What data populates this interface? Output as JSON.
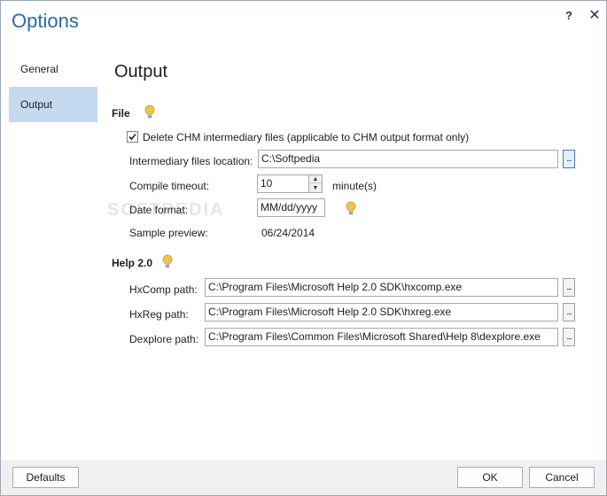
{
  "window": {
    "title": "Options"
  },
  "titlebar": {
    "help_label": "?",
    "close_label": "✕"
  },
  "sidebar": {
    "items": [
      {
        "label": "General"
      },
      {
        "label": "Output"
      }
    ]
  },
  "main": {
    "title": "Output",
    "file_section": {
      "label": "File",
      "delete_checkbox": {
        "label": "Delete CHM intermediary files (applicable to CHM output format only)",
        "checked": true
      },
      "intermediary_label": "Intermediary files location:",
      "intermediary_value": "C:\\Softpedia",
      "compile_label": "Compile timeout:",
      "compile_value": "10",
      "compile_unit": "minute(s)",
      "date_format_label": "Date format:",
      "date_format_value": "MM/dd/yyyy",
      "sample_label": "Sample preview:",
      "sample_value": "06/24/2014"
    },
    "help_section": {
      "label": "Help 2.0",
      "hxcomp_label": "HxComp path:",
      "hxcomp_value": "C:\\Program Files\\Microsoft Help 2.0 SDK\\hxcomp.exe",
      "hxreg_label": "HxReg path:",
      "hxreg_value": "C:\\Program Files\\Microsoft Help 2.0 SDK\\hxreg.exe",
      "dexplore_label": "Dexplore path:",
      "dexplore_value": "C:\\Program Files\\Common Files\\Microsoft Shared\\Help 8\\dexplore.exe"
    },
    "browse_label": "...",
    "watermark": "SOFTPEDIA"
  },
  "footer": {
    "defaults_label": "Defaults",
    "ok_label": "OK",
    "cancel_label": "Cancel"
  },
  "icons": {
    "bulb": "lightbulb-icon",
    "check": "checkmark-icon",
    "spin_up": "chevron-up-icon",
    "spin_down": "chevron-down-icon"
  },
  "colors": {
    "title": "#2b6aa8",
    "sidebar_active": "#c5d9f0",
    "footer_bg": "#f0f0f0",
    "bulb": "#f2c14e"
  }
}
